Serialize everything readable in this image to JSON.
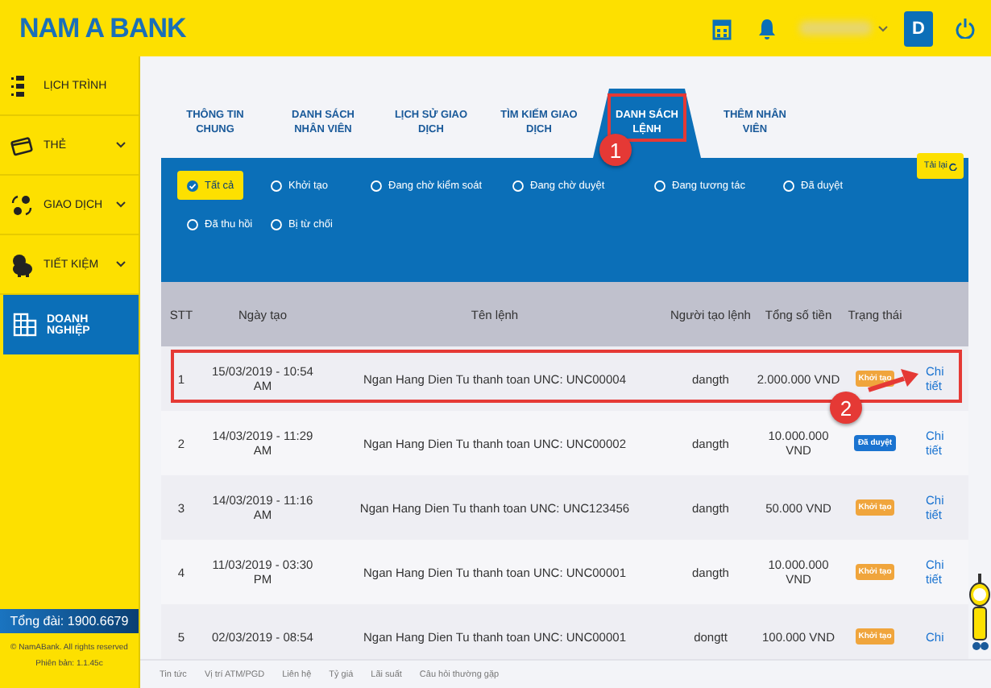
{
  "header": {
    "logo": "NAM A BANK",
    "avatar_letter": "D"
  },
  "sidebar": {
    "items": [
      {
        "label": "LỊCH TRÌNH",
        "expandable": false,
        "selected": false
      },
      {
        "label": "THẺ",
        "expandable": true,
        "selected": false
      },
      {
        "label": "GIAO DỊCH",
        "expandable": true,
        "selected": false
      },
      {
        "label": "TIẾT KIỆM",
        "expandable": true,
        "selected": false
      },
      {
        "label": "DOANH NGHIỆP",
        "expandable": false,
        "selected": true
      }
    ],
    "hotline": "Tổng đài: 1900.6679",
    "copyright": "© NamABank. All rights reserved",
    "version": "Phiên bản: 1.1.45c"
  },
  "tabs": [
    {
      "label": "THÔNG TIN CHUNG",
      "selected": false,
      "highlighted": false
    },
    {
      "label": "DANH SÁCH NHÂN VIÊN",
      "selected": false,
      "highlighted": false
    },
    {
      "label": "LỊCH SỬ GIAO DỊCH",
      "selected": false,
      "highlighted": false
    },
    {
      "label": "TÌM KIẾM GIAO DỊCH",
      "selected": false,
      "highlighted": false
    },
    {
      "label": "DANH SÁCH LỆNH",
      "selected": true,
      "highlighted": true
    },
    {
      "label": "THÊM NHÂN VIÊN",
      "selected": false,
      "highlighted": false
    }
  ],
  "reload_button": "Tải lại",
  "filters": [
    {
      "label": "Tất cả",
      "selected": true
    },
    {
      "label": "Khởi tạo",
      "selected": false
    },
    {
      "label": "Đang chờ kiểm soát",
      "selected": false
    },
    {
      "label": "Đang chờ duyệt",
      "selected": false
    },
    {
      "label": "Đang tương tác",
      "selected": false
    },
    {
      "label": "Đã duyệt",
      "selected": false
    },
    {
      "label": "Đã thu hồi",
      "selected": false
    },
    {
      "label": "Bị từ chối",
      "selected": false
    }
  ],
  "table": {
    "columns": [
      "STT",
      "Ngày tạo",
      "Tên lệnh",
      "Người tạo lệnh",
      "Tổng số tiền",
      "Trạng thái"
    ],
    "rows": [
      {
        "stt": "1",
        "date": "15/03/2019 - 10:54 AM",
        "name": "Ngan Hang Dien Tu thanh toan UNC: UNC00004",
        "creator": "dangth",
        "amount": "2.000.000 VND",
        "status": {
          "label": "Khởi tạo",
          "color": "#f0a53c"
        },
        "link": "Chi tiết",
        "highlighted": true
      },
      {
        "stt": "2",
        "date": "14/03/2019 - 11:29 AM",
        "name": "Ngan Hang Dien Tu thanh toan UNC: UNC00002",
        "creator": "dangth",
        "amount": "10.000.000 VND",
        "status": {
          "label": "Đã duyệt",
          "color": "#1a73d0"
        },
        "link": "Chi tiết",
        "highlighted": false
      },
      {
        "stt": "3",
        "date": "14/03/2019 - 11:16 AM",
        "name": "Ngan Hang Dien Tu thanh toan UNC: UNC123456",
        "creator": "dangth",
        "amount": "50.000 VND",
        "status": {
          "label": "Khởi tạo",
          "color": "#f0a53c"
        },
        "link": "Chi tiết",
        "highlighted": false
      },
      {
        "stt": "4",
        "date": "11/03/2019 - 03:30 PM",
        "name": "Ngan Hang Dien Tu thanh toan UNC: UNC00001",
        "creator": "dangth",
        "amount": "10.000.000 VND",
        "status": {
          "label": "Khởi tạo",
          "color": "#f0a53c"
        },
        "link": "Chi tiết",
        "highlighted": false
      },
      {
        "stt": "5",
        "date": "02/03/2019 - 08:54",
        "name": "Ngan Hang Dien Tu thanh toan UNC: UNC00001",
        "creator": "dongtt",
        "amount": "100.000 VND",
        "status": {
          "label": "Khởi tạo",
          "color": "#f0a53c"
        },
        "link": "Chi",
        "highlighted": false
      }
    ]
  },
  "footer_links": [
    "Tin tức",
    "Vị trí ATM/PGD",
    "Liên hệ",
    "Tỷ giá",
    "Lãi suất",
    "Câu hỏi thường gặp"
  ],
  "callouts": [
    {
      "label": "1"
    },
    {
      "label": "2"
    }
  ]
}
